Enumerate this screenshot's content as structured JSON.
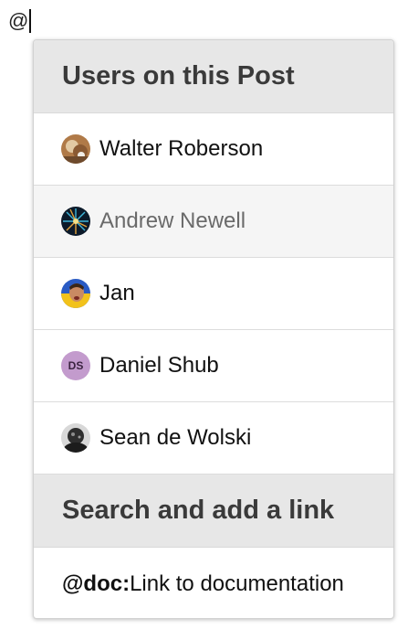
{
  "editor": {
    "typed_text": "@"
  },
  "mention_popup": {
    "users_section_title": "Users on this Post",
    "users": [
      {
        "name": "Walter Roberson",
        "avatar": "photo-avatar",
        "highlighted": false
      },
      {
        "name": "Andrew Newell",
        "avatar": "photo-avatar",
        "highlighted": true
      },
      {
        "name": "Jan",
        "avatar": "photo-avatar",
        "highlighted": false
      },
      {
        "name": "Daniel Shub",
        "avatar": "initials-avatar",
        "initials": "DS",
        "highlighted": false
      },
      {
        "name": "Sean de Wolski",
        "avatar": "photo-avatar",
        "highlighted": false
      }
    ],
    "links_section_title": "Search and add a link",
    "links": [
      {
        "keyword": "@doc:",
        "description": "Link to documentation"
      }
    ]
  },
  "colors": {
    "header_background": "#e7e7e7",
    "highlight_background": "#f5f5f5",
    "initials_avatar_background": "#c39bcd"
  }
}
